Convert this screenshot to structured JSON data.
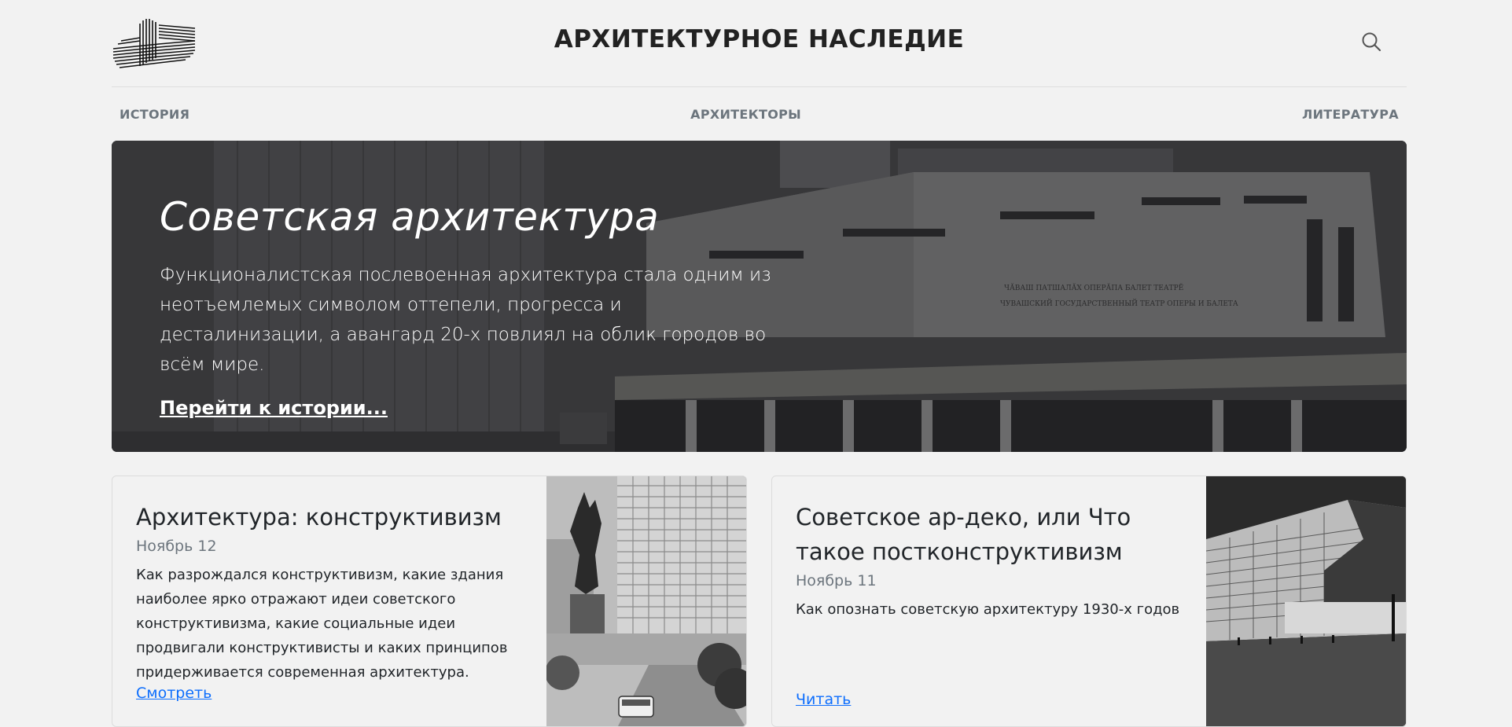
{
  "header": {
    "site_title": "АРХИТЕКТУРНОЕ НАСЛЕДИЕ",
    "logo_icon": "striped-building-logo",
    "search_icon": "search-icon"
  },
  "nav": {
    "items": [
      {
        "label": "ИСТОРИЯ"
      },
      {
        "label": "АРХИТЕКТОРЫ"
      },
      {
        "label": "ЛИТЕРАТУРА"
      }
    ]
  },
  "hero": {
    "title": "Советская архитектура",
    "text": "Функционалистская послевоенная архитектура стала одним из неотъемлемых символом оттепели, прогресса и десталинизации, а авангард 20-х повлиял на облик городов во всём мире.",
    "link_label": "Перейти к истории...",
    "building_sign_1": "ЧӐВАШ ПАТШАЛӐХ ОПЕРӐПА БАЛЕТ ТЕАТРӖ",
    "building_sign_2": "ЧУВАШСКИЙ ГОСУДАРСТВЕННЫЙ ТЕАТР ОПЕРЫ И БАЛЕТА"
  },
  "cards": [
    {
      "title": "Архитектура: конструктивизм",
      "date": "Ноябрь 12",
      "text": "Как разрождался конструктивизм, какие здания наиболее ярко отражают идеи советского конструктивизма, какие социальные идеи продвигали конструктивисты и каких принципов придерживается современная архитектура.",
      "link_label": "Смотреть"
    },
    {
      "title": "Советское ар-деко, или Что такое постконструктивизм",
      "date": "Ноябрь 11",
      "text": "Как опознать советскую архитектуру 1930-х годов",
      "link_label": "Читать"
    }
  ],
  "colors": {
    "background": "#f2f2f2",
    "link": "#0d6efd",
    "muted": "#6c757d"
  }
}
